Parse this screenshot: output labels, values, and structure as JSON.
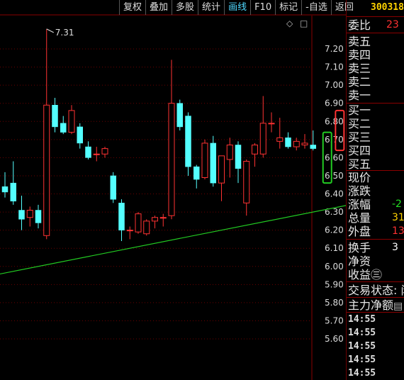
{
  "toolbar": {
    "items": [
      "复权",
      "叠加",
      "多股",
      "统计",
      "画线",
      "F10",
      "标记",
      "-自选",
      "返回"
    ],
    "active_index": 4
  },
  "right_panel": {
    "code": "300318",
    "weibi_label": "委比",
    "weibi_value": "23",
    "sell_labels": [
      "卖五",
      "卖四",
      "卖三",
      "卖二",
      "卖一"
    ],
    "buy_labels": [
      "买一",
      "买二",
      "买三",
      "买四",
      "买五"
    ],
    "quote_labels": [
      "现价",
      "涨跌",
      "涨幅",
      "总量",
      "外盘"
    ],
    "quote_values": [
      "",
      "",
      "-2",
      "31",
      "13"
    ],
    "misc_labels": [
      "换手",
      "净资",
      "收益㊂"
    ],
    "misc_values": [
      "3",
      "",
      ""
    ],
    "trade_status": "交易状态: 闭",
    "main_flow": "主力净额",
    "times": [
      "14:55",
      "14:55",
      "14:55",
      "14:55",
      "14:55"
    ]
  },
  "chart_data": {
    "type": "candlestick",
    "yticks": [
      "7.20",
      "7.10",
      "7.00",
      "6.90",
      "6.80",
      "6.70",
      "6.60",
      "6.50",
      "6.40",
      "6.30",
      "6.20",
      "6.10",
      "6.00",
      "5.90",
      "5.80",
      "5.70",
      "5.60"
    ],
    "ylim": [
      5.55,
      7.4
    ],
    "max_label": "7.31",
    "colors": {
      "up": "#ff3232",
      "down": "#54ffff",
      "trend": "#22cc22",
      "grid": "#6b0000",
      "tick": "#dcdcdc"
    },
    "candles": [
      {
        "o": 6.44,
        "h": 6.52,
        "l": 6.38,
        "c": 6.41
      },
      {
        "o": 6.46,
        "h": 6.58,
        "l": 6.34,
        "c": 6.36
      },
      {
        "o": 6.31,
        "h": 6.39,
        "l": 6.2,
        "c": 6.26
      },
      {
        "o": 6.27,
        "h": 6.33,
        "l": 6.22,
        "c": 6.31
      },
      {
        "o": 6.31,
        "h": 6.34,
        "l": 6.21,
        "c": 6.24
      },
      {
        "o": 6.17,
        "h": 7.31,
        "l": 6.15,
        "c": 6.89
      },
      {
        "o": 6.89,
        "h": 6.93,
        "l": 6.74,
        "c": 6.77
      },
      {
        "o": 6.79,
        "h": 6.83,
        "l": 6.73,
        "c": 6.74
      },
      {
        "o": 6.74,
        "h": 6.89,
        "l": 6.73,
        "c": 6.86
      },
      {
        "o": 6.77,
        "h": 6.79,
        "l": 6.65,
        "c": 6.68
      },
      {
        "o": 6.66,
        "h": 6.69,
        "l": 6.59,
        "c": 6.6
      },
      {
        "o": 6.62,
        "h": 6.66,
        "l": 6.58,
        "c": 6.62
      },
      {
        "o": 6.62,
        "h": 6.66,
        "l": 6.6,
        "c": 6.65
      },
      {
        "o": 6.5,
        "h": 6.52,
        "l": 6.35,
        "c": 6.37
      },
      {
        "o": 6.35,
        "h": 6.37,
        "l": 6.14,
        "c": 6.2
      },
      {
        "o": 6.2,
        "h": 6.22,
        "l": 6.15,
        "c": 6.2
      },
      {
        "o": 6.19,
        "h": 6.3,
        "l": 6.18,
        "c": 6.29
      },
      {
        "o": 6.18,
        "h": 6.26,
        "l": 6.17,
        "c": 6.25
      },
      {
        "o": 6.25,
        "h": 6.28,
        "l": 6.21,
        "c": 6.27
      },
      {
        "o": 6.27,
        "h": 6.29,
        "l": 6.22,
        "c": 6.27
      },
      {
        "o": 6.28,
        "h": 7.14,
        "l": 6.26,
        "c": 6.9
      },
      {
        "o": 6.9,
        "h": 6.92,
        "l": 6.75,
        "c": 6.77
      },
      {
        "o": 6.83,
        "h": 6.85,
        "l": 6.5,
        "c": 6.55
      },
      {
        "o": 6.55,
        "h": 6.56,
        "l": 6.43,
        "c": 6.48
      },
      {
        "o": 6.49,
        "h": 6.7,
        "l": 6.48,
        "c": 6.68
      },
      {
        "o": 6.68,
        "h": 6.72,
        "l": 6.44,
        "c": 6.46
      },
      {
        "o": 6.46,
        "h": 6.61,
        "l": 6.36,
        "c": 6.61
      },
      {
        "o": 6.59,
        "h": 6.71,
        "l": 6.49,
        "c": 6.67
      },
      {
        "o": 6.67,
        "h": 6.69,
        "l": 6.46,
        "c": 6.54
      },
      {
        "o": 6.35,
        "h": 6.59,
        "l": 6.28,
        "c": 6.58
      },
      {
        "o": 6.62,
        "h": 6.68,
        "l": 6.55,
        "c": 6.67
      },
      {
        "o": 6.62,
        "h": 6.94,
        "l": 6.6,
        "c": 6.79
      },
      {
        "o": 6.79,
        "h": 6.85,
        "l": 6.74,
        "c": 6.79
      },
      {
        "o": 6.69,
        "h": 6.82,
        "l": 6.65,
        "c": 6.71
      },
      {
        "o": 6.71,
        "h": 6.74,
        "l": 6.65,
        "c": 6.66
      },
      {
        "o": 6.66,
        "h": 6.71,
        "l": 6.64,
        "c": 6.69
      },
      {
        "o": 6.67,
        "h": 6.73,
        "l": 6.65,
        "c": 6.68
      },
      {
        "o": 6.67,
        "h": 6.75,
        "l": 6.64,
        "c": 6.65
      }
    ],
    "placeholders": [
      {
        "kind": "down_outline",
        "top": 6.74,
        "bottom": 6.46
      },
      {
        "kind": "up_outline",
        "top": 6.86,
        "bottom": 6.64
      }
    ],
    "trendline": {
      "x0_index": -1.5,
      "y0": 5.95,
      "x1_index": 42.5,
      "y1": 6.35
    }
  }
}
